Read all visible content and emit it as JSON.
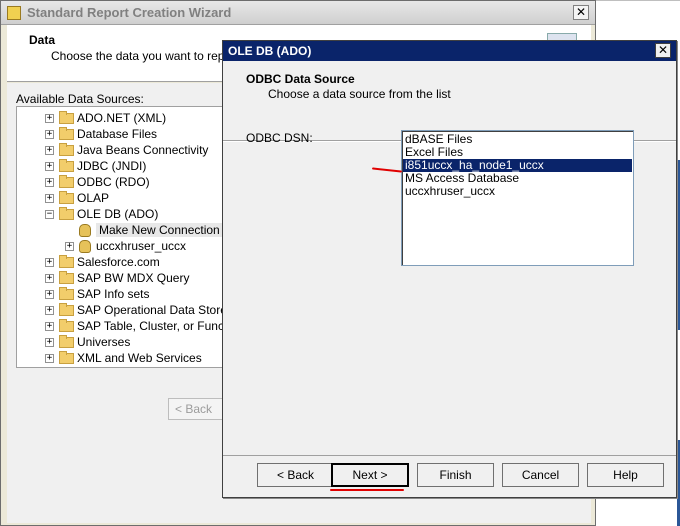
{
  "wizard": {
    "title": "Standard Report Creation Wizard",
    "close_glyph": "✕",
    "header_title": "Data",
    "header_subtitle": "Choose the data you want to report o",
    "available_label": "Available Data Sources:",
    "back_label": "< Back",
    "tree": [
      {
        "label": "ADO.NET (XML)",
        "expander": "+",
        "icon": "folder-icon"
      },
      {
        "label": "Database Files",
        "expander": "+",
        "icon": "folder-icon"
      },
      {
        "label": "Java Beans Connectivity",
        "expander": "+",
        "icon": "folder-icon"
      },
      {
        "label": "JDBC (JNDI)",
        "expander": "+",
        "icon": "folder-icon"
      },
      {
        "label": "ODBC (RDO)",
        "expander": "+",
        "icon": "folder-icon"
      },
      {
        "label": "OLAP",
        "expander": "+",
        "icon": "folder-icon"
      },
      {
        "label": "OLE DB (ADO)",
        "expander": "−",
        "icon": "folder-icon"
      },
      {
        "label": "Make New Connection",
        "expander": "",
        "icon": "database-icon",
        "selected": true
      },
      {
        "label": "uccxhruser_uccx",
        "expander": "+",
        "icon": "database-icon"
      },
      {
        "label": "Salesforce.com",
        "expander": "+",
        "icon": "folder-icon"
      },
      {
        "label": "SAP BW MDX Query",
        "expander": "+",
        "icon": "folder-icon"
      },
      {
        "label": "SAP Info sets",
        "expander": "+",
        "icon": "folder-icon"
      },
      {
        "label": "SAP Operational Data Store",
        "expander": "+",
        "icon": "folder-icon"
      },
      {
        "label": "SAP Table, Cluster, or Functio",
        "expander": "+",
        "icon": "folder-icon"
      },
      {
        "label": "Universes",
        "expander": "+",
        "icon": "folder-icon"
      },
      {
        "label": "XML and Web Services",
        "expander": "+",
        "icon": "folder-icon"
      }
    ]
  },
  "dialog": {
    "title": "OLE DB (ADO)",
    "close_glyph": "✕",
    "header_title": "ODBC Data Source",
    "header_subtitle": "Choose a data source from the list",
    "dsn_label": "ODBC DSN:",
    "dsn_items": [
      {
        "label": "dBASE Files"
      },
      {
        "label": "Excel Files"
      },
      {
        "label": "i851uccx_ha_node1_uccx",
        "selected": true
      },
      {
        "label": "MS Access Database"
      },
      {
        "label": "uccxhruser_uccx"
      }
    ],
    "buttons": {
      "back": "< Back",
      "next": "Next >",
      "finish": "Finish",
      "cancel": "Cancel",
      "help": "Help"
    }
  },
  "colors": {
    "selection": "#0a246a",
    "annotation": "#e00000"
  }
}
